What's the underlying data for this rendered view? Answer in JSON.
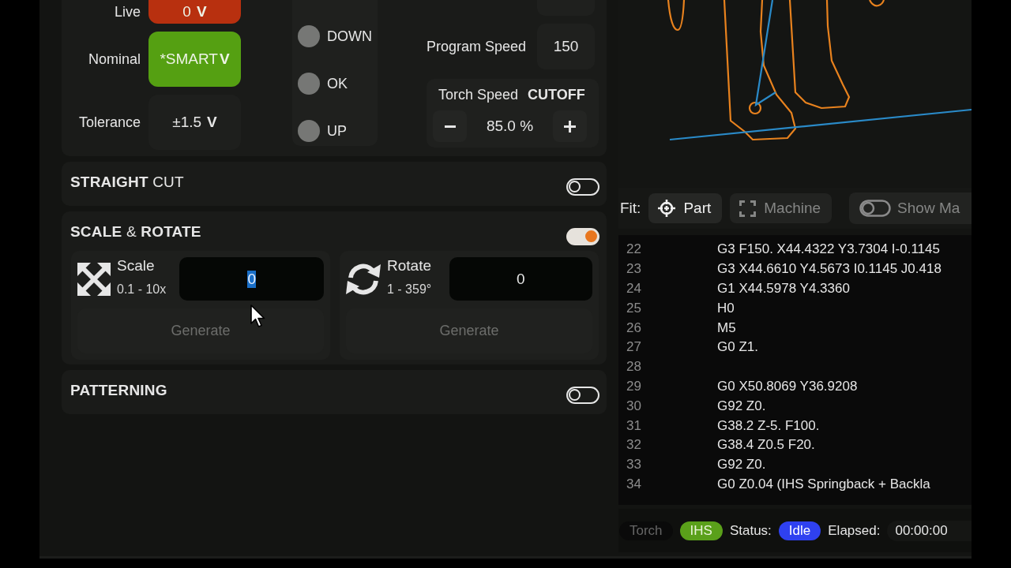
{
  "voltage": [
    {
      "kind": "live",
      "label": "Live",
      "value": "0",
      "unit": "V"
    },
    {
      "kind": "nominal",
      "label": "Nominal",
      "value": "*SMART",
      "unit": "V"
    },
    {
      "kind": "tolerance",
      "label": "Tolerance",
      "value": "±1.5",
      "unit": "V"
    }
  ],
  "indicators": [
    {
      "label": "DOWN",
      "on": false
    },
    {
      "label": "OK",
      "on": false
    },
    {
      "label": "UP",
      "on": false
    }
  ],
  "program_speed": {
    "label": "Program Speed",
    "value": "150"
  },
  "torch_speed": {
    "label": "Torch Speed",
    "mode": "CUTOFF",
    "value": "85.0 %"
  },
  "sections": [
    {
      "title": "**STRAIGHT** CUT",
      "enabled": false
    },
    {
      "title": "**SCALE** & **ROTATE**",
      "enabled": true,
      "tools": [
        {
          "kind": "scale",
          "label": "Scale",
          "range": "0.1 - 10x",
          "value": "0",
          "value_selected": true,
          "action": "Generate",
          "action_disabled": true
        },
        {
          "kind": "rotate",
          "label": "Rotate",
          "range": "1 - 359°",
          "value": "0",
          "value_selected": false,
          "action": "Generate",
          "action_disabled": true
        }
      ]
    },
    {
      "title": "PATTERNING",
      "enabled": false
    }
  ],
  "fit": {
    "label": "Fit:",
    "options": [
      {
        "kind": "part",
        "label": "Part",
        "selected": true
      },
      {
        "kind": "machine",
        "label": "Machine",
        "selected": false
      }
    ],
    "show_toggle": {
      "label": "Show Ma",
      "on": false
    }
  },
  "gcode": {
    "lines": [
      {
        "number": "22",
        "code": "G3 F150. X44.4322 Y3.7304 I-0.1145"
      },
      {
        "number": "23",
        "code": "G3 X44.6610 Y4.5673 I0.1145 J0.418"
      },
      {
        "number": "24",
        "code": "G1 X44.5978 Y4.3360"
      },
      {
        "number": "25",
        "code": "H0"
      },
      {
        "number": "26",
        "code": "M5"
      },
      {
        "number": "27",
        "code": "G0 Z1."
      },
      {
        "number": "28"
      },
      {
        "number": "29",
        "code": "G0 X50.8069 Y36.9208"
      },
      {
        "number": "30",
        "code": "G92 Z0."
      },
      {
        "number": "31",
        "code": "G38.2 Z-5. F100."
      },
      {
        "number": "32",
        "code": "G38.4 Z0.5 F20."
      },
      {
        "number": "33",
        "code": "G92 Z0."
      },
      {
        "number": "34",
        "code": "G0 Z0.04 (IHS Springback + Backla"
      }
    ]
  },
  "status_bar": {
    "badges": [
      {
        "label": "Torch",
        "on": false
      },
      {
        "label": "IHS",
        "on": true
      }
    ],
    "status_label": "Status:",
    "status": "Idle",
    "elapsed_label": "Elapsed:",
    "elapsed": "00:00:00"
  }
}
